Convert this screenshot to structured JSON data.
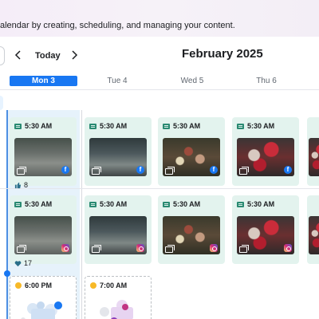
{
  "header": {
    "intro_text": "alendar by creating, scheduling, and managing your content."
  },
  "calendar": {
    "today_label": "Today",
    "month_title": "February 2025",
    "days": [
      {
        "label": "Mon 3",
        "active": true
      },
      {
        "label": "Tue 4",
        "active": false
      },
      {
        "label": "Wed 5",
        "active": false
      },
      {
        "label": "Thu 6",
        "active": false
      }
    ]
  },
  "posts": {
    "row1": [
      {
        "time": "5:30 AM",
        "platform": "facebook",
        "metric_icon": "thumbs-up-icon",
        "metric": "8"
      },
      {
        "time": "5:30 AM",
        "platform": "facebook"
      },
      {
        "time": "5:30 AM",
        "platform": "facebook"
      },
      {
        "time": "5:30 AM",
        "platform": "facebook"
      }
    ],
    "row2": [
      {
        "time": "5:30 AM",
        "platform": "instagram",
        "metric_icon": "heart-icon",
        "metric": "17"
      },
      {
        "time": "5:30 AM",
        "platform": "instagram"
      },
      {
        "time": "5:30 AM",
        "platform": "instagram"
      },
      {
        "time": "5:30 AM",
        "platform": "instagram"
      }
    ],
    "planned": [
      {
        "time": "6:00 PM"
      },
      {
        "time": "7:00 AM"
      }
    ]
  },
  "colors": {
    "accent": "#1877f2",
    "post_card_bg": "#e3f3ee",
    "today_column_bg": "#e6f2fb",
    "time_icon": "#2a8a72"
  }
}
